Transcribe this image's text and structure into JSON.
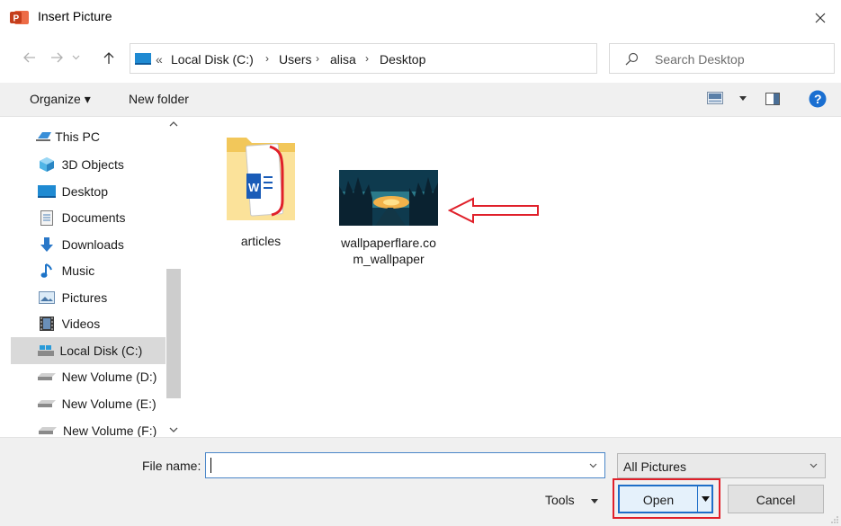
{
  "window": {
    "title": "Insert Picture"
  },
  "address": {
    "overflow": "«",
    "crumbs": [
      "Local Disk (C:)",
      "Users",
      "alisa",
      "Desktop"
    ],
    "search_placeholder": "Search Desktop"
  },
  "toolbar": {
    "organize": "Organize ▾",
    "new_folder": "New folder"
  },
  "nav": {
    "items": [
      {
        "label": "This PC",
        "icon": "pc-icon"
      },
      {
        "label": "3D Objects",
        "icon": "3d-objects-icon"
      },
      {
        "label": "Desktop",
        "icon": "desktop-icon"
      },
      {
        "label": "Documents",
        "icon": "documents-icon"
      },
      {
        "label": "Downloads",
        "icon": "downloads-icon"
      },
      {
        "label": "Music",
        "icon": "music-icon"
      },
      {
        "label": "Pictures",
        "icon": "pictures-icon"
      },
      {
        "label": "Videos",
        "icon": "videos-icon"
      },
      {
        "label": "Local Disk (C:)",
        "icon": "drive-icon",
        "selected": true
      },
      {
        "label": "New Volume (D:)",
        "icon": "drive-icon"
      },
      {
        "label": "New Volume (E:)",
        "icon": "drive-icon"
      },
      {
        "label": "New Volume (F:)",
        "icon": "drive-icon"
      }
    ]
  },
  "files": [
    {
      "name": "articles",
      "type": "folder"
    },
    {
      "name": "wallpaperflare.com_wallpaper",
      "line1": "wallpaperflare.co",
      "line2": "m_wallpaper",
      "type": "image"
    }
  ],
  "bottom": {
    "file_name_label": "File name:",
    "file_name_value": "",
    "filter": "All Pictures",
    "tools": "Tools",
    "open": "Open",
    "cancel": "Cancel"
  },
  "colors": {
    "accent": "#1e6ec8",
    "highlight": "#e0202a",
    "toolbar_bg": "#f0f0f0"
  }
}
